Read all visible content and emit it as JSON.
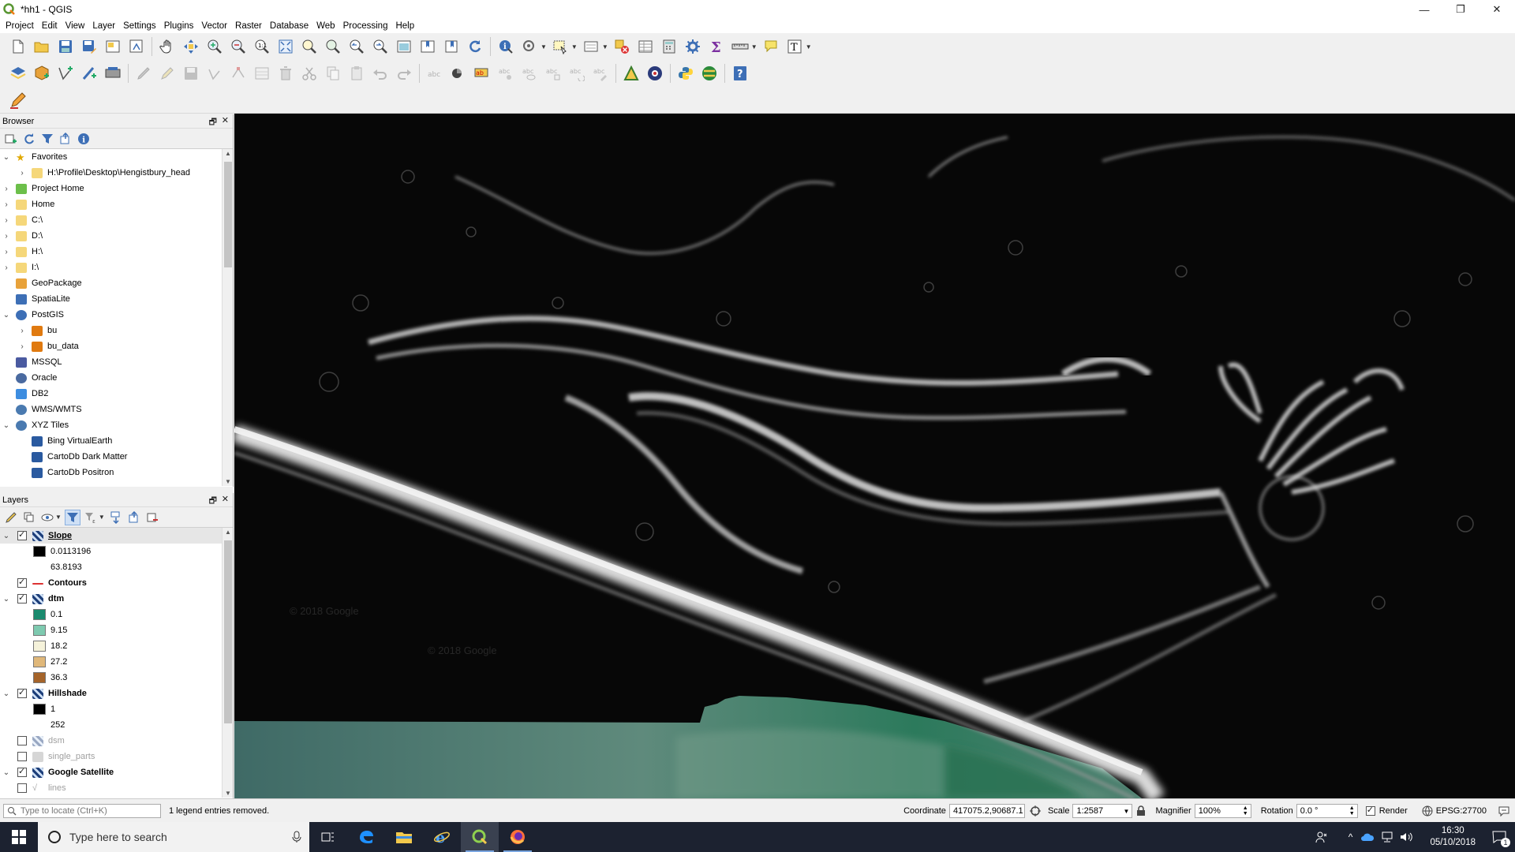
{
  "window": {
    "title": "*hh1 - QGIS",
    "controls": [
      "—",
      "❐",
      "✕"
    ]
  },
  "menus": [
    "Project",
    "Edit",
    "View",
    "Layer",
    "Settings",
    "Plugins",
    "Vector",
    "Raster",
    "Database",
    "Web",
    "Processing",
    "Help"
  ],
  "browser": {
    "title": "Browser",
    "items": [
      {
        "label": "Favorites",
        "level": 0,
        "arrow": "v",
        "icon": "star-icon"
      },
      {
        "label": "H:\\Profile\\Desktop\\Hengistbury_head",
        "level": 1,
        "arrow": ">",
        "icon": "folder-icon"
      },
      {
        "label": "Project Home",
        "level": 0,
        "arrow": ">",
        "icon": "project-home-icon"
      },
      {
        "label": "Home",
        "level": 0,
        "arrow": ">",
        "icon": "folder-icon"
      },
      {
        "label": "C:\\",
        "level": 0,
        "arrow": ">",
        "icon": "folder-icon"
      },
      {
        "label": "D:\\",
        "level": 0,
        "arrow": ">",
        "icon": "folder-icon"
      },
      {
        "label": "H:\\",
        "level": 0,
        "arrow": ">",
        "icon": "folder-icon"
      },
      {
        "label": "I:\\",
        "level": 0,
        "arrow": ">",
        "icon": "folder-icon"
      },
      {
        "label": "GeoPackage",
        "level": 0,
        "arrow": "",
        "icon": "geopackage-icon"
      },
      {
        "label": "SpatiaLite",
        "level": 0,
        "arrow": "",
        "icon": "spatialite-icon"
      },
      {
        "label": "PostGIS",
        "level": 0,
        "arrow": "v",
        "icon": "postgis-icon"
      },
      {
        "label": "bu",
        "level": 1,
        "arrow": ">",
        "icon": "connection-icon"
      },
      {
        "label": "bu_data",
        "level": 1,
        "arrow": ">",
        "icon": "connection-icon"
      },
      {
        "label": "MSSQL",
        "level": 0,
        "arrow": "",
        "icon": "mssql-icon"
      },
      {
        "label": "Oracle",
        "level": 0,
        "arrow": "",
        "icon": "oracle-icon"
      },
      {
        "label": "DB2",
        "level": 0,
        "arrow": "",
        "icon": "db2-icon"
      },
      {
        "label": "WMS/WMTS",
        "level": 0,
        "arrow": "",
        "icon": "globe-icon"
      },
      {
        "label": "XYZ Tiles",
        "level": 0,
        "arrow": "v",
        "icon": "globe-icon"
      },
      {
        "label": "Bing VirtualEarth",
        "level": 1,
        "arrow": "",
        "icon": "tiles-icon"
      },
      {
        "label": "CartoDb Dark Matter",
        "level": 1,
        "arrow": "",
        "icon": "tiles-icon"
      },
      {
        "label": "CartoDb Positron",
        "level": 1,
        "arrow": "",
        "icon": "tiles-icon"
      }
    ]
  },
  "layers": {
    "title": "Layers",
    "items": [
      {
        "kind": "layer",
        "label": "Slope",
        "checked": true,
        "arrow": "v",
        "icon": "raster-icon",
        "selected": true,
        "greyed": false
      },
      {
        "kind": "legend",
        "label": "0.0113196",
        "color": "#000000"
      },
      {
        "kind": "legend",
        "label": "63.8193",
        "color": ""
      },
      {
        "kind": "layer",
        "label": "Contours",
        "checked": true,
        "arrow": "",
        "icon": "line-symbol-icon",
        "selected": false,
        "greyed": false
      },
      {
        "kind": "layer",
        "label": "dtm",
        "checked": true,
        "arrow": "v",
        "icon": "raster-icon",
        "selected": false,
        "greyed": false
      },
      {
        "kind": "legend",
        "label": "0.1",
        "color": "#1a8a6e"
      },
      {
        "kind": "legend",
        "label": "9.15",
        "color": "#7ecab0"
      },
      {
        "kind": "legend",
        "label": "18.2",
        "color": "#f5f2da"
      },
      {
        "kind": "legend",
        "label": "27.2",
        "color": "#e0b87a"
      },
      {
        "kind": "legend",
        "label": "36.3",
        "color": "#a5642a"
      },
      {
        "kind": "layer",
        "label": "Hillshade",
        "checked": true,
        "arrow": "v",
        "icon": "raster-icon",
        "selected": false,
        "greyed": false
      },
      {
        "kind": "legend",
        "label": "1",
        "color": "#000000"
      },
      {
        "kind": "legend",
        "label": "252",
        "color": ""
      },
      {
        "kind": "layer",
        "label": "dsm",
        "checked": false,
        "arrow": "",
        "icon": "raster-icon",
        "selected": false,
        "greyed": true
      },
      {
        "kind": "layer",
        "label": "single_parts",
        "checked": false,
        "arrow": "",
        "icon": "polygon-icon",
        "selected": false,
        "greyed": true
      },
      {
        "kind": "layer",
        "label": "Google Satellite",
        "checked": true,
        "arrow": "v",
        "icon": "raster-icon",
        "selected": false,
        "greyed": false
      },
      {
        "kind": "layer",
        "label": "lines",
        "checked": false,
        "arrow": "",
        "icon": "line-icon",
        "selected": false,
        "greyed": true
      }
    ]
  },
  "map": {
    "watermarks": [
      "© 2018 Google",
      "© 2018 Google"
    ]
  },
  "status": {
    "locator_placeholder": "Type to locate (Ctrl+K)",
    "message": "1 legend entries removed.",
    "coordinate_label": "Coordinate",
    "coordinate_value": "417075.2,90687.1",
    "scale_label": "Scale",
    "scale_value": "1:2587",
    "magnifier_label": "Magnifier",
    "magnifier_value": "100%",
    "rotation_label": "Rotation",
    "rotation_value": "0.0 °",
    "render_label": "Render",
    "crs": "EPSG:27700"
  },
  "taskbar": {
    "search_placeholder": "Type here to search",
    "time": "16:30",
    "date": "05/10/2018",
    "notification_count": "1"
  }
}
